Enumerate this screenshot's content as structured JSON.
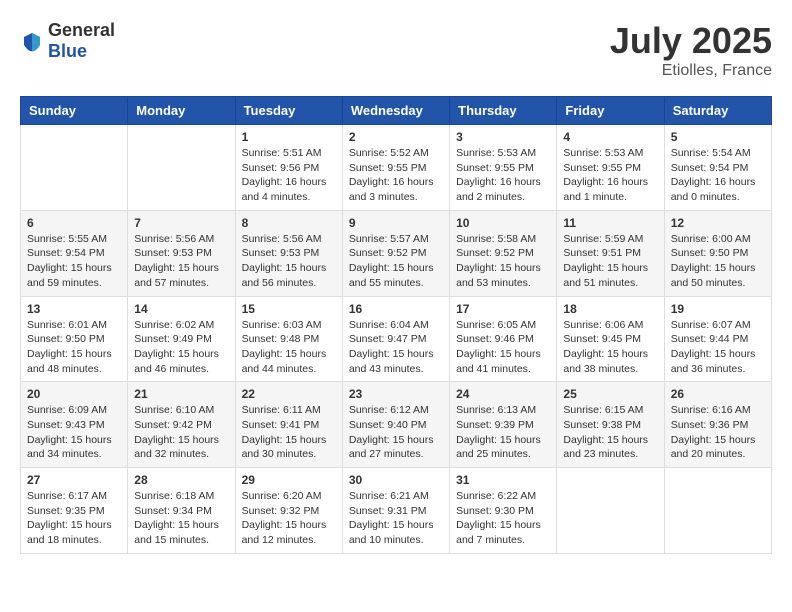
{
  "header": {
    "logo_general": "General",
    "logo_blue": "Blue",
    "month": "July 2025",
    "location": "Etiolles, France"
  },
  "weekdays": [
    "Sunday",
    "Monday",
    "Tuesday",
    "Wednesday",
    "Thursday",
    "Friday",
    "Saturday"
  ],
  "weeks": [
    [
      {
        "day": "",
        "info": ""
      },
      {
        "day": "",
        "info": ""
      },
      {
        "day": "1",
        "info": "Sunrise: 5:51 AM\nSunset: 9:56 PM\nDaylight: 16 hours\nand 4 minutes."
      },
      {
        "day": "2",
        "info": "Sunrise: 5:52 AM\nSunset: 9:55 PM\nDaylight: 16 hours\nand 3 minutes."
      },
      {
        "day": "3",
        "info": "Sunrise: 5:53 AM\nSunset: 9:55 PM\nDaylight: 16 hours\nand 2 minutes."
      },
      {
        "day": "4",
        "info": "Sunrise: 5:53 AM\nSunset: 9:55 PM\nDaylight: 16 hours\nand 1 minute."
      },
      {
        "day": "5",
        "info": "Sunrise: 5:54 AM\nSunset: 9:54 PM\nDaylight: 16 hours\nand 0 minutes."
      }
    ],
    [
      {
        "day": "6",
        "info": "Sunrise: 5:55 AM\nSunset: 9:54 PM\nDaylight: 15 hours\nand 59 minutes."
      },
      {
        "day": "7",
        "info": "Sunrise: 5:56 AM\nSunset: 9:53 PM\nDaylight: 15 hours\nand 57 minutes."
      },
      {
        "day": "8",
        "info": "Sunrise: 5:56 AM\nSunset: 9:53 PM\nDaylight: 15 hours\nand 56 minutes."
      },
      {
        "day": "9",
        "info": "Sunrise: 5:57 AM\nSunset: 9:52 PM\nDaylight: 15 hours\nand 55 minutes."
      },
      {
        "day": "10",
        "info": "Sunrise: 5:58 AM\nSunset: 9:52 PM\nDaylight: 15 hours\nand 53 minutes."
      },
      {
        "day": "11",
        "info": "Sunrise: 5:59 AM\nSunset: 9:51 PM\nDaylight: 15 hours\nand 51 minutes."
      },
      {
        "day": "12",
        "info": "Sunrise: 6:00 AM\nSunset: 9:50 PM\nDaylight: 15 hours\nand 50 minutes."
      }
    ],
    [
      {
        "day": "13",
        "info": "Sunrise: 6:01 AM\nSunset: 9:50 PM\nDaylight: 15 hours\nand 48 minutes."
      },
      {
        "day": "14",
        "info": "Sunrise: 6:02 AM\nSunset: 9:49 PM\nDaylight: 15 hours\nand 46 minutes."
      },
      {
        "day": "15",
        "info": "Sunrise: 6:03 AM\nSunset: 9:48 PM\nDaylight: 15 hours\nand 44 minutes."
      },
      {
        "day": "16",
        "info": "Sunrise: 6:04 AM\nSunset: 9:47 PM\nDaylight: 15 hours\nand 43 minutes."
      },
      {
        "day": "17",
        "info": "Sunrise: 6:05 AM\nSunset: 9:46 PM\nDaylight: 15 hours\nand 41 minutes."
      },
      {
        "day": "18",
        "info": "Sunrise: 6:06 AM\nSunset: 9:45 PM\nDaylight: 15 hours\nand 38 minutes."
      },
      {
        "day": "19",
        "info": "Sunrise: 6:07 AM\nSunset: 9:44 PM\nDaylight: 15 hours\nand 36 minutes."
      }
    ],
    [
      {
        "day": "20",
        "info": "Sunrise: 6:09 AM\nSunset: 9:43 PM\nDaylight: 15 hours\nand 34 minutes."
      },
      {
        "day": "21",
        "info": "Sunrise: 6:10 AM\nSunset: 9:42 PM\nDaylight: 15 hours\nand 32 minutes."
      },
      {
        "day": "22",
        "info": "Sunrise: 6:11 AM\nSunset: 9:41 PM\nDaylight: 15 hours\nand 30 minutes."
      },
      {
        "day": "23",
        "info": "Sunrise: 6:12 AM\nSunset: 9:40 PM\nDaylight: 15 hours\nand 27 minutes."
      },
      {
        "day": "24",
        "info": "Sunrise: 6:13 AM\nSunset: 9:39 PM\nDaylight: 15 hours\nand 25 minutes."
      },
      {
        "day": "25",
        "info": "Sunrise: 6:15 AM\nSunset: 9:38 PM\nDaylight: 15 hours\nand 23 minutes."
      },
      {
        "day": "26",
        "info": "Sunrise: 6:16 AM\nSunset: 9:36 PM\nDaylight: 15 hours\nand 20 minutes."
      }
    ],
    [
      {
        "day": "27",
        "info": "Sunrise: 6:17 AM\nSunset: 9:35 PM\nDaylight: 15 hours\nand 18 minutes."
      },
      {
        "day": "28",
        "info": "Sunrise: 6:18 AM\nSunset: 9:34 PM\nDaylight: 15 hours\nand 15 minutes."
      },
      {
        "day": "29",
        "info": "Sunrise: 6:20 AM\nSunset: 9:32 PM\nDaylight: 15 hours\nand 12 minutes."
      },
      {
        "day": "30",
        "info": "Sunrise: 6:21 AM\nSunset: 9:31 PM\nDaylight: 15 hours\nand 10 minutes."
      },
      {
        "day": "31",
        "info": "Sunrise: 6:22 AM\nSunset: 9:30 PM\nDaylight: 15 hours\nand 7 minutes."
      },
      {
        "day": "",
        "info": ""
      },
      {
        "day": "",
        "info": ""
      }
    ]
  ]
}
